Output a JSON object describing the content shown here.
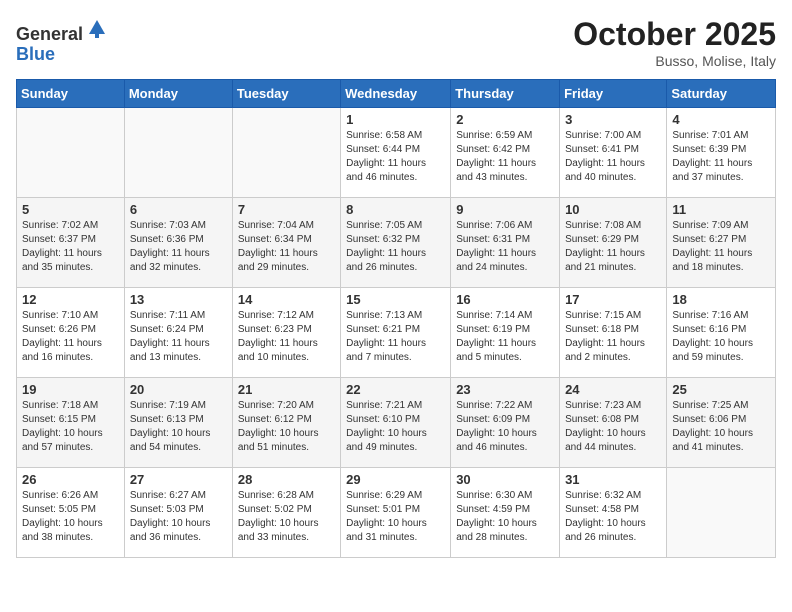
{
  "header": {
    "logo_general": "General",
    "logo_blue": "Blue",
    "month": "October 2025",
    "location": "Busso, Molise, Italy"
  },
  "weekdays": [
    "Sunday",
    "Monday",
    "Tuesday",
    "Wednesday",
    "Thursday",
    "Friday",
    "Saturday"
  ],
  "weeks": [
    [
      {
        "day": "",
        "info": ""
      },
      {
        "day": "",
        "info": ""
      },
      {
        "day": "",
        "info": ""
      },
      {
        "day": "1",
        "info": "Sunrise: 6:58 AM\nSunset: 6:44 PM\nDaylight: 11 hours and 46 minutes."
      },
      {
        "day": "2",
        "info": "Sunrise: 6:59 AM\nSunset: 6:42 PM\nDaylight: 11 hours and 43 minutes."
      },
      {
        "day": "3",
        "info": "Sunrise: 7:00 AM\nSunset: 6:41 PM\nDaylight: 11 hours and 40 minutes."
      },
      {
        "day": "4",
        "info": "Sunrise: 7:01 AM\nSunset: 6:39 PM\nDaylight: 11 hours and 37 minutes."
      }
    ],
    [
      {
        "day": "5",
        "info": "Sunrise: 7:02 AM\nSunset: 6:37 PM\nDaylight: 11 hours and 35 minutes."
      },
      {
        "day": "6",
        "info": "Sunrise: 7:03 AM\nSunset: 6:36 PM\nDaylight: 11 hours and 32 minutes."
      },
      {
        "day": "7",
        "info": "Sunrise: 7:04 AM\nSunset: 6:34 PM\nDaylight: 11 hours and 29 minutes."
      },
      {
        "day": "8",
        "info": "Sunrise: 7:05 AM\nSunset: 6:32 PM\nDaylight: 11 hours and 26 minutes."
      },
      {
        "day": "9",
        "info": "Sunrise: 7:06 AM\nSunset: 6:31 PM\nDaylight: 11 hours and 24 minutes."
      },
      {
        "day": "10",
        "info": "Sunrise: 7:08 AM\nSunset: 6:29 PM\nDaylight: 11 hours and 21 minutes."
      },
      {
        "day": "11",
        "info": "Sunrise: 7:09 AM\nSunset: 6:27 PM\nDaylight: 11 hours and 18 minutes."
      }
    ],
    [
      {
        "day": "12",
        "info": "Sunrise: 7:10 AM\nSunset: 6:26 PM\nDaylight: 11 hours and 16 minutes."
      },
      {
        "day": "13",
        "info": "Sunrise: 7:11 AM\nSunset: 6:24 PM\nDaylight: 11 hours and 13 minutes."
      },
      {
        "day": "14",
        "info": "Sunrise: 7:12 AM\nSunset: 6:23 PM\nDaylight: 11 hours and 10 minutes."
      },
      {
        "day": "15",
        "info": "Sunrise: 7:13 AM\nSunset: 6:21 PM\nDaylight: 11 hours and 7 minutes."
      },
      {
        "day": "16",
        "info": "Sunrise: 7:14 AM\nSunset: 6:19 PM\nDaylight: 11 hours and 5 minutes."
      },
      {
        "day": "17",
        "info": "Sunrise: 7:15 AM\nSunset: 6:18 PM\nDaylight: 11 hours and 2 minutes."
      },
      {
        "day": "18",
        "info": "Sunrise: 7:16 AM\nSunset: 6:16 PM\nDaylight: 10 hours and 59 minutes."
      }
    ],
    [
      {
        "day": "19",
        "info": "Sunrise: 7:18 AM\nSunset: 6:15 PM\nDaylight: 10 hours and 57 minutes."
      },
      {
        "day": "20",
        "info": "Sunrise: 7:19 AM\nSunset: 6:13 PM\nDaylight: 10 hours and 54 minutes."
      },
      {
        "day": "21",
        "info": "Sunrise: 7:20 AM\nSunset: 6:12 PM\nDaylight: 10 hours and 51 minutes."
      },
      {
        "day": "22",
        "info": "Sunrise: 7:21 AM\nSunset: 6:10 PM\nDaylight: 10 hours and 49 minutes."
      },
      {
        "day": "23",
        "info": "Sunrise: 7:22 AM\nSunset: 6:09 PM\nDaylight: 10 hours and 46 minutes."
      },
      {
        "day": "24",
        "info": "Sunrise: 7:23 AM\nSunset: 6:08 PM\nDaylight: 10 hours and 44 minutes."
      },
      {
        "day": "25",
        "info": "Sunrise: 7:25 AM\nSunset: 6:06 PM\nDaylight: 10 hours and 41 minutes."
      }
    ],
    [
      {
        "day": "26",
        "info": "Sunrise: 6:26 AM\nSunset: 5:05 PM\nDaylight: 10 hours and 38 minutes."
      },
      {
        "day": "27",
        "info": "Sunrise: 6:27 AM\nSunset: 5:03 PM\nDaylight: 10 hours and 36 minutes."
      },
      {
        "day": "28",
        "info": "Sunrise: 6:28 AM\nSunset: 5:02 PM\nDaylight: 10 hours and 33 minutes."
      },
      {
        "day": "29",
        "info": "Sunrise: 6:29 AM\nSunset: 5:01 PM\nDaylight: 10 hours and 31 minutes."
      },
      {
        "day": "30",
        "info": "Sunrise: 6:30 AM\nSunset: 4:59 PM\nDaylight: 10 hours and 28 minutes."
      },
      {
        "day": "31",
        "info": "Sunrise: 6:32 AM\nSunset: 4:58 PM\nDaylight: 10 hours and 26 minutes."
      },
      {
        "day": "",
        "info": ""
      }
    ]
  ]
}
